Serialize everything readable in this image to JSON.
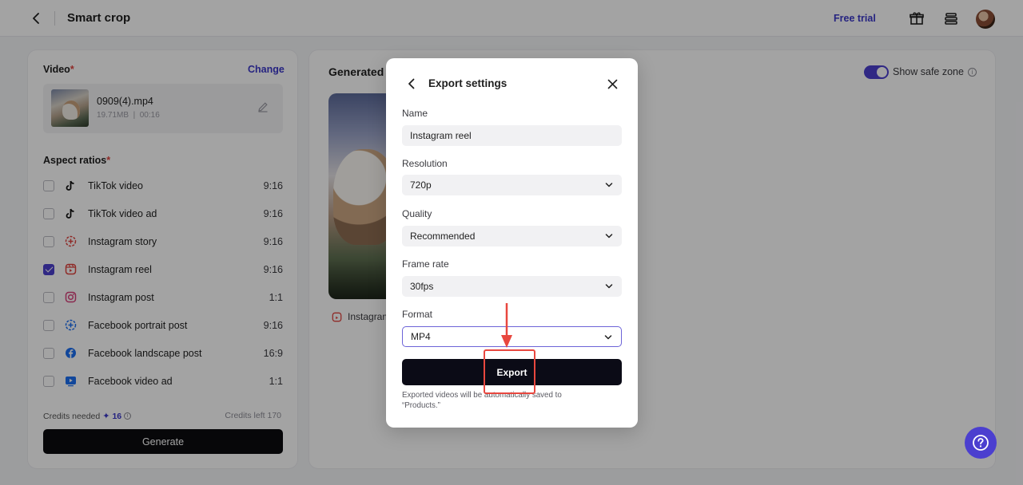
{
  "header": {
    "title": "Smart crop",
    "free_trial": "Free trial"
  },
  "left_panel": {
    "video_label": "Video",
    "required_mark": "*",
    "change": "Change",
    "file": {
      "name": "0909(4).mp4",
      "size": "19.71MB",
      "duration": "00:16"
    },
    "aspect_label": "Aspect ratios",
    "ratios": [
      {
        "name": "TikTok video",
        "ratio": "9:16",
        "checked": false,
        "icon": "tiktok-icon"
      },
      {
        "name": "TikTok video ad",
        "ratio": "9:16",
        "checked": false,
        "icon": "tiktok-icon"
      },
      {
        "name": "Instagram story",
        "ratio": "9:16",
        "checked": false,
        "icon": "instagram-story-icon"
      },
      {
        "name": "Instagram reel",
        "ratio": "9:16",
        "checked": true,
        "icon": "instagram-reel-icon"
      },
      {
        "name": "Instagram post",
        "ratio": "1:1",
        "checked": false,
        "icon": "instagram-icon"
      },
      {
        "name": "Facebook portrait post",
        "ratio": "9:16",
        "checked": false,
        "icon": "facebook-story-icon"
      },
      {
        "name": "Facebook landscape post",
        "ratio": "16:9",
        "checked": false,
        "icon": "facebook-icon"
      },
      {
        "name": "Facebook video ad",
        "ratio": "1:1",
        "checked": false,
        "icon": "facebook-video-icon"
      }
    ],
    "credits_needed_label": "Credits needed",
    "credits_needed_value": "16",
    "credits_left": "Credits left 170",
    "generate": "Generate"
  },
  "right_panel": {
    "title": "Generated",
    "show_safe_zone": "Show safe zone",
    "preview_label": "Instagram"
  },
  "modal": {
    "title": "Export settings",
    "name_label": "Name",
    "name_value": "Instagram reel",
    "resolution_label": "Resolution",
    "resolution_value": "720p",
    "quality_label": "Quality",
    "quality_value": "Recommended",
    "frame_rate_label": "Frame rate",
    "frame_rate_value": "30fps",
    "format_label": "Format",
    "format_value": "MP4",
    "export": "Export",
    "note": "Exported videos will be automatically saved to “Products.”"
  },
  "colors": {
    "accent": "#4b3fcf",
    "link": "#3b37c9",
    "annotation": "#e8473f"
  }
}
